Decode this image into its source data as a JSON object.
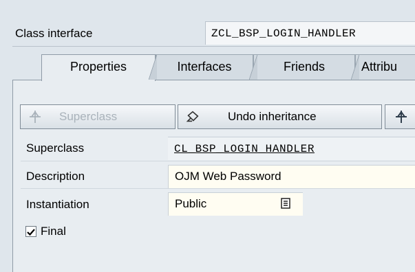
{
  "header": {
    "class_interface_label": "Class interface",
    "class_name": "ZCL_BSP_LOGIN_HANDLER"
  },
  "tabs": [
    {
      "label": "Properties",
      "active": true
    },
    {
      "label": "Interfaces",
      "active": false
    },
    {
      "label": "Friends",
      "active": false
    },
    {
      "label": "Attribu",
      "active": false
    }
  ],
  "toolbar": {
    "superclass_button": "Superclass",
    "undo_inheritance_button": "Undo inheritance"
  },
  "form": {
    "superclass_label": "Superclass",
    "superclass_value": "CL_BSP_LOGIN_HANDLER",
    "description_label": "Description",
    "description_value": "OJM Web Password",
    "instantiation_label": "Instantiation",
    "instantiation_value": "Public",
    "final_label": "Final",
    "final_checked": true
  },
  "colors": {
    "background": "#dfe6ec",
    "panel": "#e8edf1",
    "input": "#fffdf2",
    "disabled_text": "#a9b2ba"
  }
}
